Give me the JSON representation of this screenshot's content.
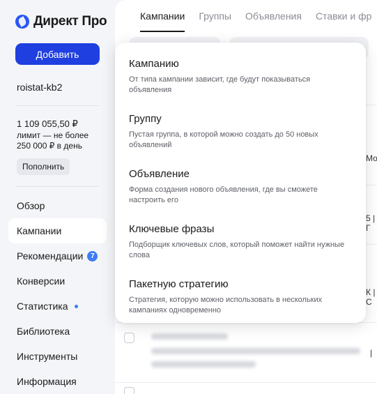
{
  "app": {
    "logo_text": "Директ Про"
  },
  "sidebar": {
    "add_label": "Добавить",
    "account": "roistat-kb2",
    "balance": "1 109 055,50 ₽",
    "limit": "лимит — не более 250 000 ₽ в день",
    "topup_label": "Пополнить",
    "nav": [
      {
        "label": "Обзор"
      },
      {
        "label": "Кампании"
      },
      {
        "label": "Рекомендации",
        "badge": "7"
      },
      {
        "label": "Конверсии"
      },
      {
        "label": "Статистика"
      },
      {
        "label": "Библиотека"
      },
      {
        "label": "Инструменты"
      },
      {
        "label": "Информация"
      }
    ]
  },
  "tabs": [
    "Кампании",
    "Группы",
    "Объявления",
    "Ставки и фр"
  ],
  "peek": [
    "Моск",
    "5 | Г",
    "К | С",
    "| "
  ],
  "menu": [
    {
      "title": "Кампанию",
      "desc": "От типа кампании зависит, где будут показываться объявления"
    },
    {
      "title": "Группу",
      "desc": "Пустая группа, в которой можно создать до 50 новых объявлений"
    },
    {
      "title": "Объявление",
      "desc": "Форма создания нового объявления, где вы сможете настроить его"
    },
    {
      "title": "Ключевые фразы",
      "desc": "Подборщик ключевых слов, который поможет найти нужные слова"
    },
    {
      "title": "Пакетную стратегию",
      "desc": "Стратегия, которую можно использовать в нескольких кампаниях одновременно"
    }
  ],
  "colors": {
    "accent": "#1f3fe0",
    "badge": "#3d7cf5",
    "background": "#f4f5f8"
  }
}
